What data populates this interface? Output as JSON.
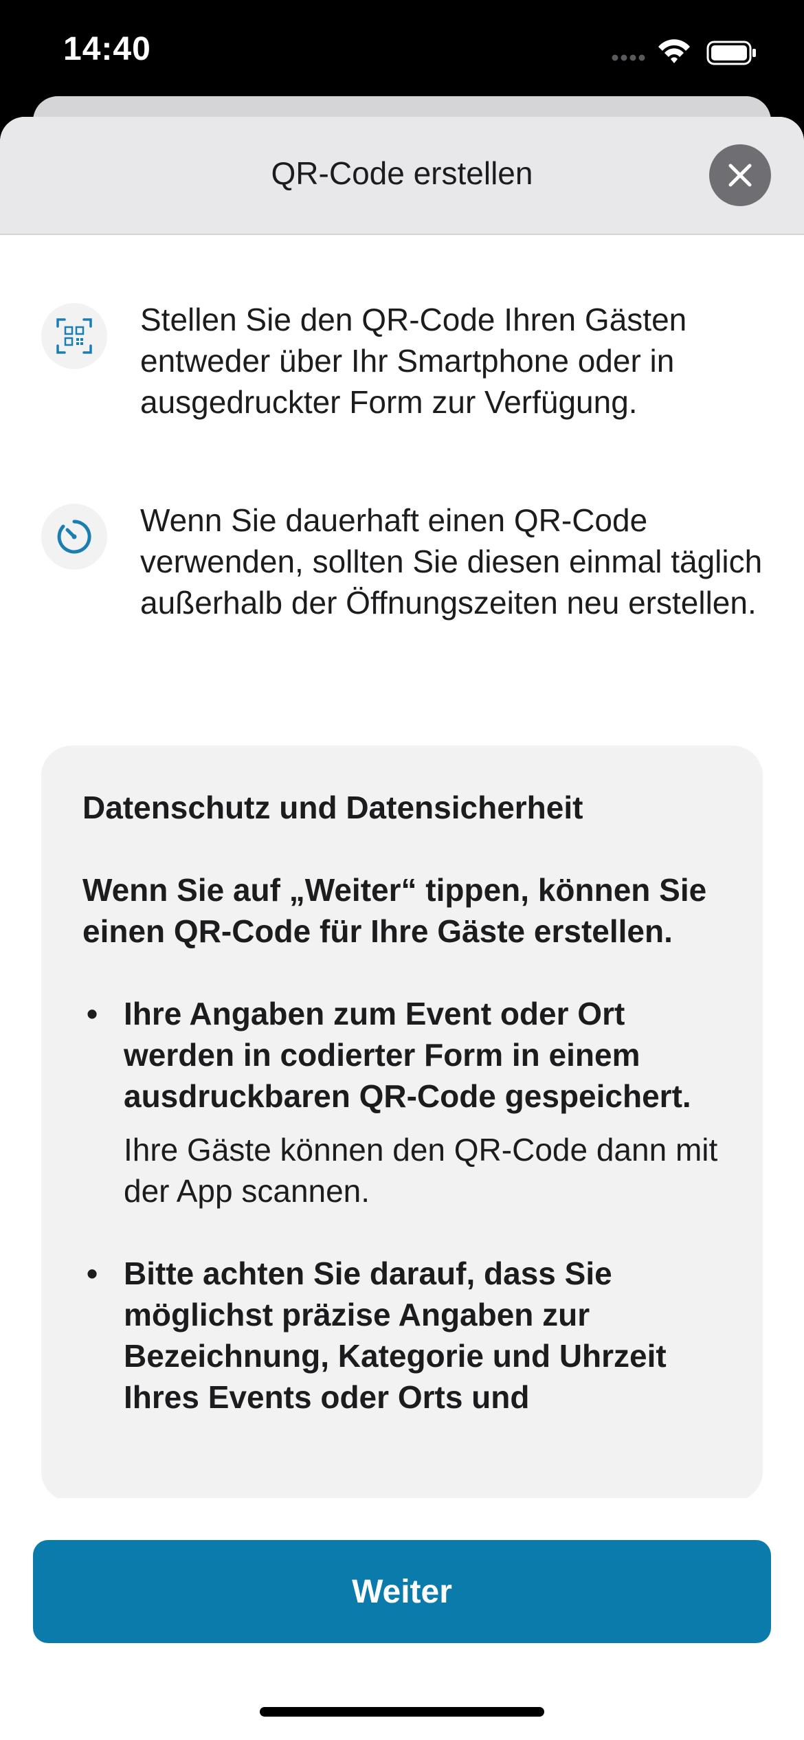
{
  "status_bar": {
    "time": "14:40"
  },
  "sheet": {
    "title": "QR-Code erstellen",
    "close_icon": "close-icon"
  },
  "info_items": [
    {
      "icon": "qr-code-icon",
      "text": "Stellen Sie den QR-Code Ihren Gästen entweder über Ihr Smartphone oder in ausgedruckter Form zur Verfügung."
    },
    {
      "icon": "timer-icon",
      "text": "Wenn Sie dauerhaft einen QR-Code verwenden, sollten Sie diesen einmal täglich außerhalb der Öffnungszeiten neu erstellen."
    }
  ],
  "privacy": {
    "title": "Datenschutz und Datensicherheit",
    "intro": "Wenn Sie auf „Weiter“ tippen, können Sie einen QR-Code für Ihre Gäste erstellen.",
    "bullets": [
      {
        "bold": "Ihre Angaben zum Event oder Ort werden in codierter Form in einem ausdruckbaren QR-Code gespeichert.",
        "sub": "Ihre Gäste können den QR-Code dann mit der App scannen."
      },
      {
        "bold": "Bitte achten Sie darauf, dass Sie möglichst präzise Angaben zur Bezeichnung, Kategorie und Uhrzeit Ihres Events oder Orts und"
      }
    ]
  },
  "footer": {
    "continue_label": "Weiter"
  },
  "colors": {
    "accent": "#0b7bac",
    "icon_tint": "#1a7fb0",
    "card_background": "#f2f2f3"
  }
}
